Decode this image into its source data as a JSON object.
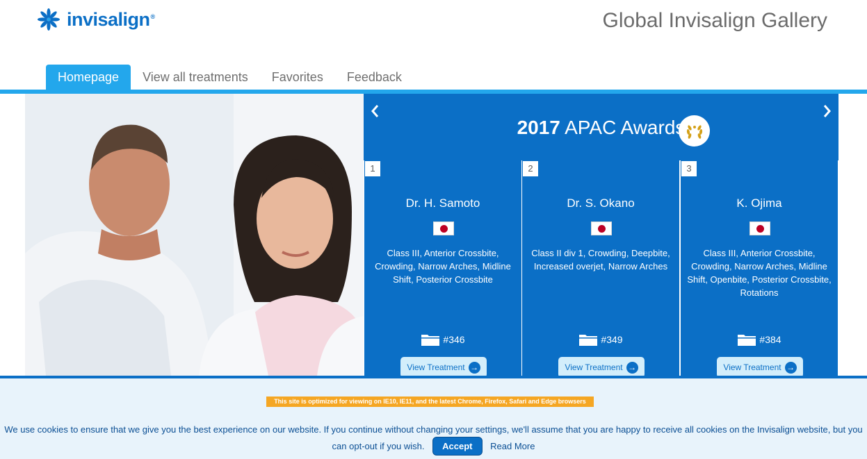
{
  "brand": {
    "logo_text": "invisalign",
    "logo_reg": "®",
    "accent": "#0b6fc6",
    "nav_accent": "#23a7ec"
  },
  "header": {
    "site_title": "Global Invisalign Gallery"
  },
  "nav": {
    "items": [
      {
        "label": "Homepage",
        "active": true
      },
      {
        "label": "View all treatments",
        "active": false
      },
      {
        "label": "Favorites",
        "active": false
      },
      {
        "label": "Feedback",
        "active": false
      }
    ]
  },
  "awards": {
    "year": "2017",
    "title": "APAC Awards",
    "prev_icon": "chevron-left-icon",
    "next_icon": "chevron-right-icon",
    "badge_icon": "laurel-wreath-icon",
    "cards": [
      {
        "rank": "1",
        "name": "Dr. H. Samoto",
        "flag": "japan-flag-icon",
        "description": "Class III, Anterior Crossbite, Crowding, Narrow Arches, Midline Shift, Posterior Crossbite",
        "case_number": "#346",
        "button_label": "View Treatment"
      },
      {
        "rank": "2",
        "name": "Dr. S. Okano",
        "flag": "japan-flag-icon",
        "description": "Class II div 1, Crowding, Deepbite, Increased overjet, Narrow Arches",
        "case_number": "#349",
        "button_label": "View Treatment"
      },
      {
        "rank": "3",
        "name": "K. Ojima",
        "flag": "japan-flag-icon",
        "description": "Class III, Anterior Crossbite, Crowding, Narrow Arches, Midline Shift, Openbite, Posterior Crossbite, Rotations",
        "case_number": "#384",
        "button_label": "View Treatment"
      }
    ]
  },
  "cookie": {
    "browser_note": "This site is optimized for viewing on IE10, IE11, and the latest Chrome, Firefox, Safari and Edge browsers",
    "message": "We use cookies to ensure that we give you the best experience on our website. If you continue without changing your settings, we'll assume that you are happy to receive all cookies on the Invisalign website, but you can opt-out if you wish.",
    "accept_label": "Accept",
    "read_more_label": "Read More"
  }
}
